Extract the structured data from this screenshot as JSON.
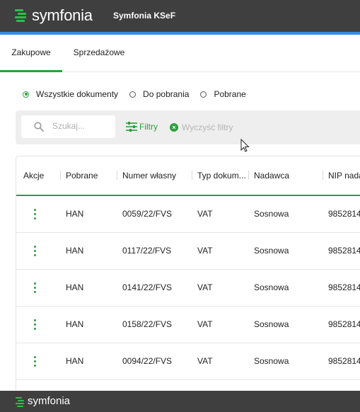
{
  "header": {
    "logo_text": "symfonia",
    "app_title": "Symfonia KSeF",
    "brand_color": "#26c24a",
    "accent_color": "#2f8fe6"
  },
  "tabs": [
    {
      "label": "Zakupowe",
      "active": true
    },
    {
      "label": "Sprzedażowe",
      "active": false
    }
  ],
  "document_filter": {
    "options": [
      {
        "label": "Wszystkie dokumenty",
        "selected": true
      },
      {
        "label": "Do pobrania",
        "selected": false
      },
      {
        "label": "Pobrane",
        "selected": false
      }
    ]
  },
  "toolbar": {
    "search_placeholder": "Szukaj...",
    "search_icon": "search-icon",
    "filters_label": "Filtry",
    "filters_icon": "sliders-icon",
    "clear_filters_label": "Wyczyść filtry",
    "clear_icon": "close-circle-icon"
  },
  "table": {
    "columns": [
      "Akcje",
      "Pobrane",
      "Numer własny",
      "Typ dokum...",
      "Nadawca",
      "NIP nada"
    ],
    "rows": [
      {
        "pobrane": "HAN",
        "numer": "0059/22/FVS",
        "typ": "VAT",
        "nadawca": "Sosnowa",
        "nip": "9852814"
      },
      {
        "pobrane": "HAN",
        "numer": "0117/22/FVS",
        "typ": "VAT",
        "nadawca": "Sosnowa",
        "nip": "9852814"
      },
      {
        "pobrane": "HAN",
        "numer": "0141/22/FVS",
        "typ": "VAT",
        "nadawca": "Sosnowa",
        "nip": "9852814"
      },
      {
        "pobrane": "HAN",
        "numer": "0158/22/FVS",
        "typ": "VAT",
        "nadawca": "Sosnowa",
        "nip": "9852814"
      },
      {
        "pobrane": "HAN",
        "numer": "0094/22/FVS",
        "typ": "VAT",
        "nadawca": "Sosnowa",
        "nip": "9852814"
      }
    ],
    "row_action_icon": "kebab-menu-icon"
  },
  "footer": {
    "logo_text": "symfonia"
  }
}
